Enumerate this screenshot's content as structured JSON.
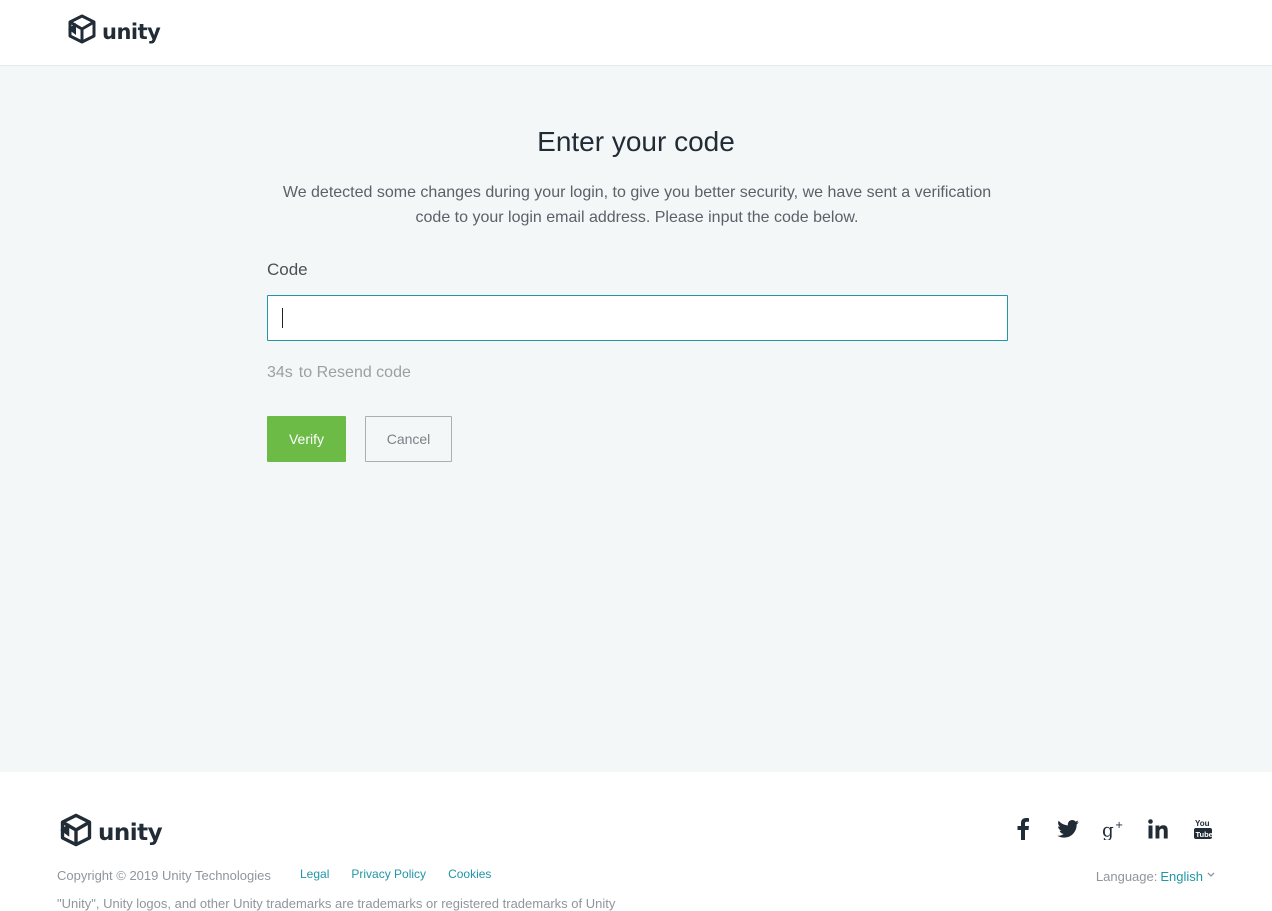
{
  "header": {
    "logo_text": "unity"
  },
  "main": {
    "title": "Enter your code",
    "description": "We detected some changes during your login, to give you better security, we have sent a verification code to your login email address. Please input the code below.",
    "code_label": "Code",
    "code_value": "",
    "resend_countdown": "34s",
    "resend_text": "to Resend code",
    "verify_label": "Verify",
    "cancel_label": "Cancel"
  },
  "footer": {
    "logo_text": "unity",
    "copyright": "Copyright © 2019 Unity Technologies",
    "links": [
      "Legal",
      "Privacy Policy",
      "Cookies"
    ],
    "trademark": "\"Unity\", Unity logos, and other Unity trademarks are trademarks or registered trademarks of Unity",
    "language_label": "Language:",
    "language_value": "English",
    "social": [
      "facebook-icon",
      "twitter-icon",
      "google-plus-icon",
      "linkedin-icon",
      "youtube-icon"
    ]
  },
  "colors": {
    "accent": "#2196a6",
    "verify": "#6cbb47",
    "brand_dark": "#222c37"
  }
}
